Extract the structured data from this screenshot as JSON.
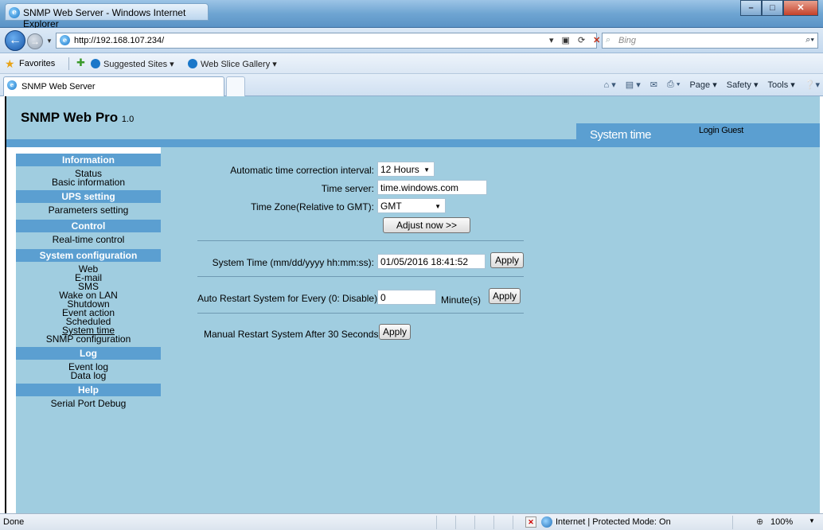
{
  "browser": {
    "window_title": "SNMP Web Server - Windows Internet Explorer",
    "url": "http://192.168.107.234/",
    "search_placeholder": "Bing",
    "favorites_label": "Favorites",
    "fav_items": [
      "Suggested Sites ▾",
      "Web Slice Gallery ▾"
    ],
    "tab_title": "SNMP Web Server",
    "commands": [
      "Page ▾",
      "Safety ▾",
      "Tools ▾"
    ],
    "status_text": "Done",
    "zone_text": "Internet | Protected Mode: On",
    "zoom": "100%"
  },
  "app": {
    "brand": "SNMP Web Pro",
    "version": "1.0",
    "current_page": "System time",
    "login_label": "Login",
    "login_user": "Guest"
  },
  "sidebar": [
    {
      "header": "Information",
      "items": [
        "Status",
        "Basic information"
      ]
    },
    {
      "header": "UPS setting",
      "items": [
        "Parameters setting"
      ]
    },
    {
      "header": "Control",
      "items": [
        "Real-time control"
      ]
    },
    {
      "header": "System configuration",
      "items": [
        "Web",
        "E-mail",
        "SMS",
        "Wake on LAN",
        "Shutdown",
        "Event action",
        "Scheduled",
        "System time",
        "SNMP configuration"
      ]
    },
    {
      "header": "Log",
      "items": [
        "Event log",
        "Data log"
      ]
    },
    {
      "header": "Help",
      "items": [
        "Serial Port Debug"
      ]
    }
  ],
  "form": {
    "interval_label": "Automatic time correction interval:",
    "interval_value": "12 Hours",
    "server_label": "Time server:",
    "server_value": "time.windows.com",
    "zone_label": "Time Zone(Relative to GMT):",
    "zone_value": "GMT",
    "adjust_button": "Adjust now >>",
    "systime_label": "System Time (mm/dd/yyyy hh:mm:ss):",
    "systime_value": "01/05/2016 18:41:52",
    "apply_label": "Apply",
    "restart_label": "Auto Restart System for Every (0: Disable):",
    "restart_value": "0",
    "restart_unit": "Minute(s)",
    "manual_label": "Manual Restart System After 30 Seconds."
  }
}
